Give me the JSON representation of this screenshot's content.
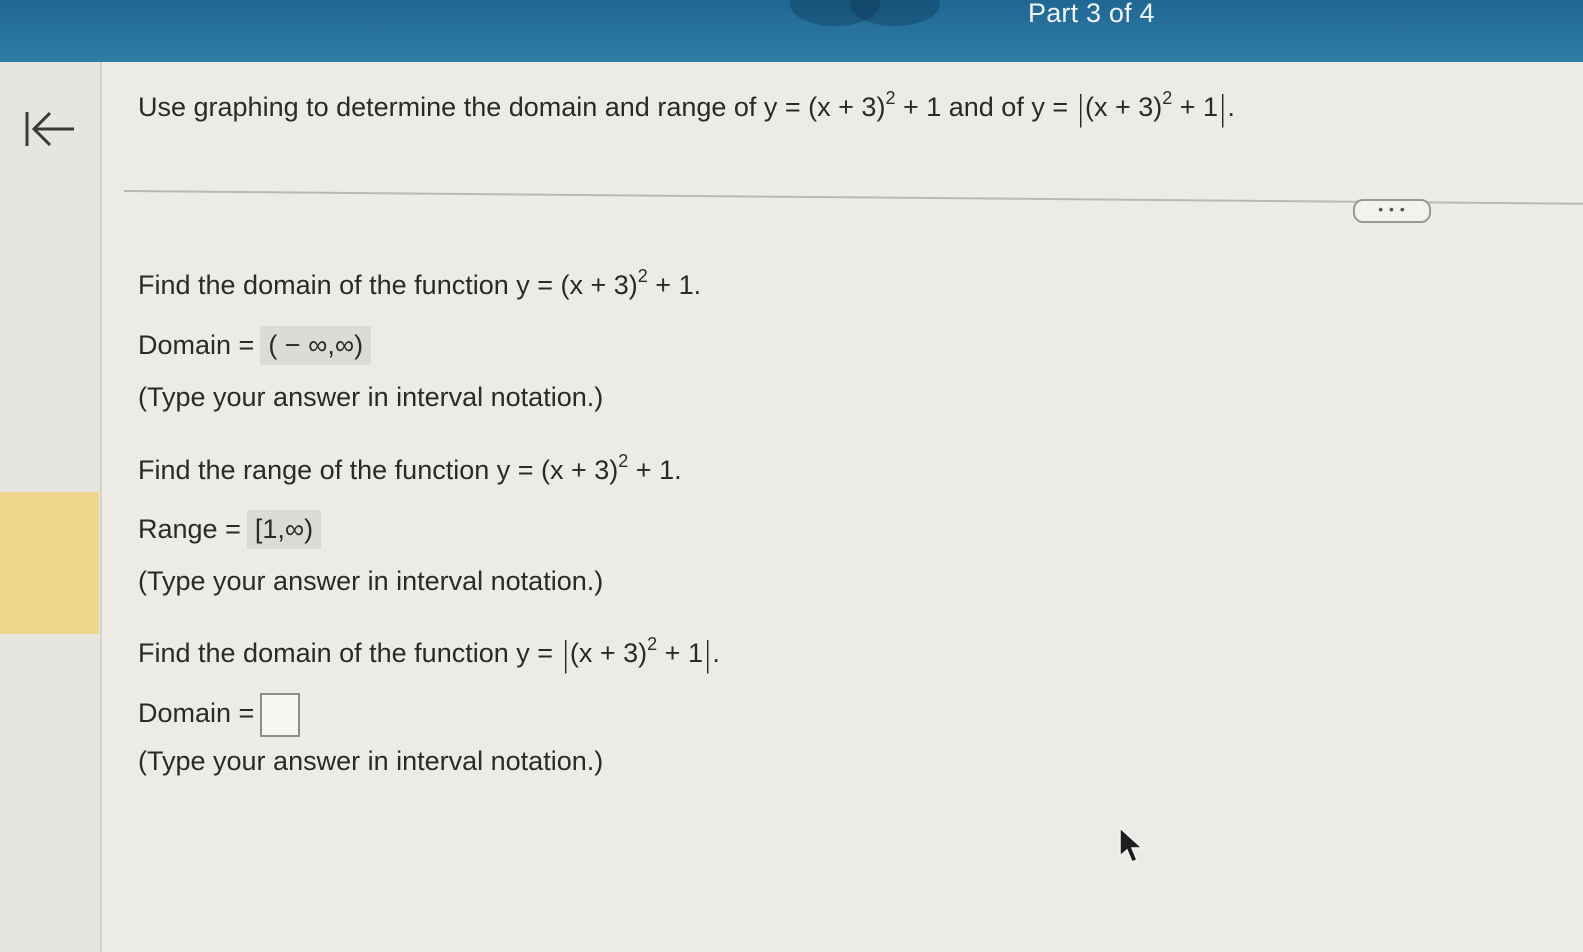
{
  "header": {
    "part_label": "Part 3 of 4"
  },
  "question": {
    "lead": "Use graphing to determine the domain and range of y = (x + 3)",
    "exp": "2",
    "mid": " + 1 and of y = ",
    "abs_inner": "(x + 3)",
    "abs_exp": "2",
    "abs_tail": " + 1",
    "end": "."
  },
  "more_button": {
    "label": "• • •"
  },
  "part1": {
    "prompt": "Find the domain of the function y = (x + 3)",
    "exp": "2",
    "prompt_end": " + 1.",
    "label": "Domain =",
    "answer": "( − ∞,∞)",
    "hint": "(Type your answer in interval notation.)"
  },
  "part2": {
    "prompt": "Find the range of the function y = (x + 3)",
    "exp": "2",
    "prompt_end": " + 1.",
    "label": "Range =",
    "answer": "[1,∞)",
    "hint": "(Type your answer in interval notation.)"
  },
  "part3": {
    "prompt": "Find the domain of the function y = ",
    "abs_inner": "(x + 3)",
    "abs_exp": "2",
    "abs_tail": " + 1",
    "prompt_end": ".",
    "label": "Domain =",
    "answer": "",
    "hint": "(Type your answer in interval notation.)"
  },
  "icons": {
    "back": "back-to-start-icon",
    "cursor": "mouse-pointer-icon"
  },
  "colors": {
    "header": "#2b77a2",
    "marker": "#efd68d",
    "answer_bg": "#dcdcd6"
  }
}
